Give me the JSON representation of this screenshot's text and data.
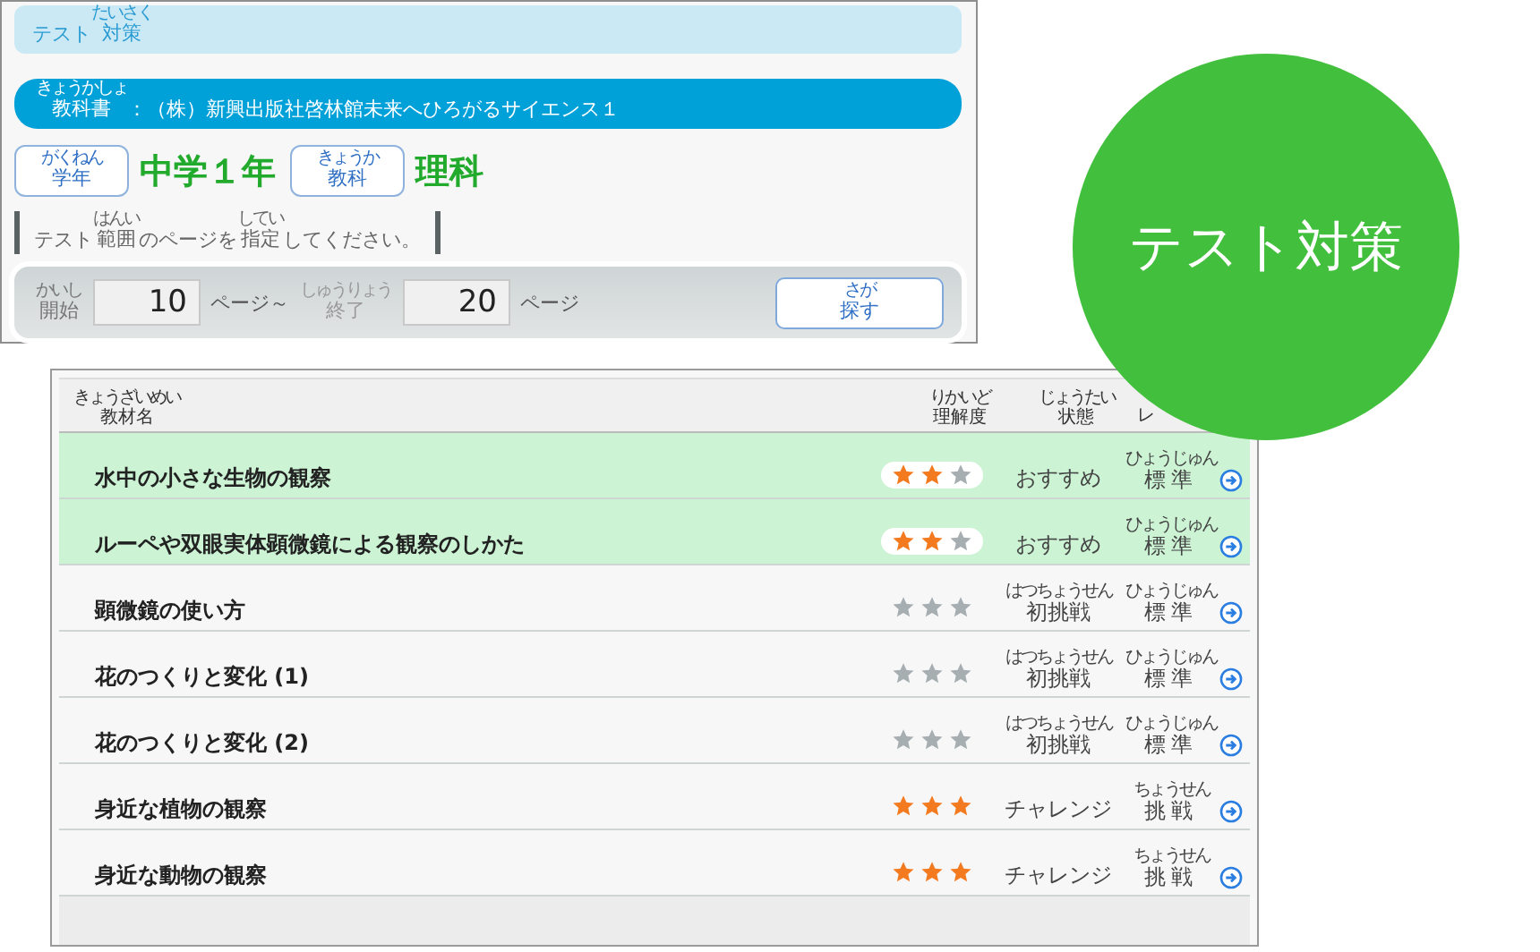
{
  "header": {
    "title": [
      {
        "text": "テスト"
      },
      {
        "text": "対策",
        "ruby": "たいさく"
      }
    ]
  },
  "textbook": {
    "label": [
      {
        "text": "教科書",
        "ruby": "きょうかしょ"
      },
      {
        "text": "：（株）新興出版社啓林館未来へひろがるサイエンス１"
      }
    ]
  },
  "grade": {
    "button": [
      {
        "text": "学年",
        "ruby": "がくねん"
      }
    ],
    "value": "中学１年"
  },
  "subject": {
    "button": [
      {
        "text": "教科",
        "ruby": "きょうか"
      }
    ],
    "value": "理科"
  },
  "instruction": [
    {
      "text": "テスト"
    },
    {
      "text": "範囲",
      "ruby": "はんい"
    },
    {
      "text": "のページを"
    },
    {
      "text": "指定",
      "ruby": "してい"
    },
    {
      "text": "してください。"
    }
  ],
  "search": {
    "start_label": [
      {
        "text": "開始",
        "ruby": "かいし"
      }
    ],
    "start_value": "10",
    "start_unit": "ページ～",
    "end_label": [
      {
        "text": "終了",
        "ruby": "しゅうりょう"
      }
    ],
    "end_value": "20",
    "end_unit": "ページ",
    "button": [
      {
        "text": "探す",
        "ruby": "さが"
      }
    ]
  },
  "table": {
    "columns": [
      [
        {
          "text": "教材名",
          "ruby": "きょうざいめい"
        }
      ],
      [
        {
          "text": "理解度",
          "ruby": "りかいど"
        }
      ],
      [
        {
          "text": "状態",
          "ruby": "じょうたい"
        }
      ],
      [
        {
          "text": "レ"
        }
      ]
    ],
    "rows": [
      {
        "name": "水中の小さな生物の観察",
        "highlighted": true,
        "stars": 2,
        "status": [
          {
            "text": "おすすめ"
          }
        ],
        "level": [
          {
            "text": "標準",
            "ruby": "ひょうじゅん"
          }
        ]
      },
      {
        "name": "ルーペや双眼実体顕微鏡による観察のしかた",
        "highlighted": true,
        "stars": 2,
        "status": [
          {
            "text": "おすすめ"
          }
        ],
        "level": [
          {
            "text": "標準",
            "ruby": "ひょうじゅん"
          }
        ]
      },
      {
        "name": "顕微鏡の使い方",
        "highlighted": false,
        "stars": 0,
        "status": [
          {
            "text": "初挑戦",
            "ruby": "はつちょうせん"
          }
        ],
        "level": [
          {
            "text": "標準",
            "ruby": "ひょうじゅん"
          }
        ]
      },
      {
        "name": "花のつくりと変化 (1)",
        "highlighted": false,
        "stars": 0,
        "status": [
          {
            "text": "初挑戦",
            "ruby": "はつちょうせん"
          }
        ],
        "level": [
          {
            "text": "標準",
            "ruby": "ひょうじゅん"
          }
        ]
      },
      {
        "name": "花のつくりと変化 (2)",
        "highlighted": false,
        "stars": 0,
        "status": [
          {
            "text": "初挑戦",
            "ruby": "はつちょうせん"
          }
        ],
        "level": [
          {
            "text": "標準",
            "ruby": "ひょうじゅん"
          }
        ]
      },
      {
        "name": "身近な植物の観察",
        "highlighted": false,
        "stars": 3,
        "status": [
          {
            "text": "チャレンジ"
          }
        ],
        "level": [
          {
            "text": "挑戦",
            "ruby": "ちょうせん"
          }
        ]
      },
      {
        "name": "身近な動物の観察",
        "highlighted": false,
        "stars": 3,
        "status": [
          {
            "text": "チャレンジ"
          }
        ],
        "level": [
          {
            "text": "挑戦",
            "ruby": "ちょうせん"
          }
        ]
      }
    ]
  },
  "badge": {
    "text": "テスト対策"
  }
}
